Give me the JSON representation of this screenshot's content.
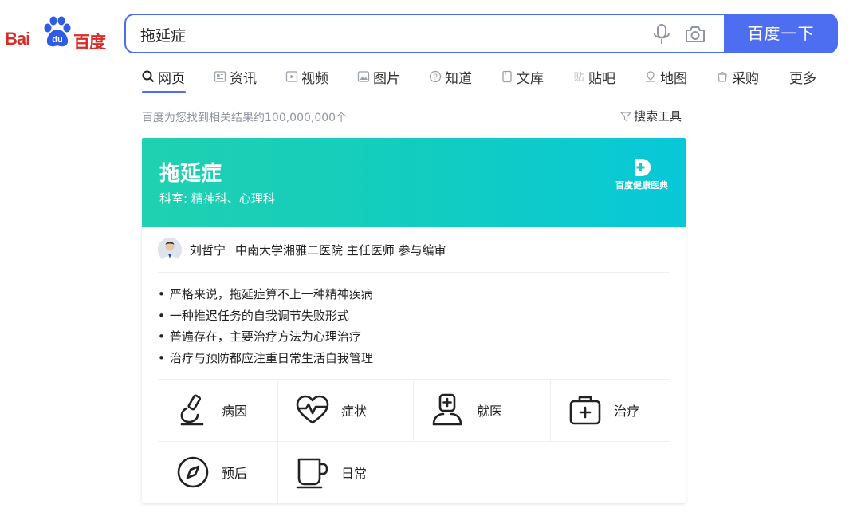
{
  "logo": {
    "part1": "Bai",
    "part2": "百度",
    "paw_text": "du"
  },
  "search": {
    "query": "拖延症",
    "button_label": "百度一下"
  },
  "tabs": [
    {
      "label": "网页",
      "icon": "search-icon"
    },
    {
      "label": "资讯",
      "icon": "news-icon"
    },
    {
      "label": "视频",
      "icon": "video-icon"
    },
    {
      "label": "图片",
      "icon": "image-icon"
    },
    {
      "label": "知道",
      "icon": "question-icon"
    },
    {
      "label": "文库",
      "icon": "document-icon"
    },
    {
      "label": "贴吧",
      "icon": "tieba-icon"
    },
    {
      "label": "地图",
      "icon": "map-icon"
    },
    {
      "label": "采购",
      "icon": "shopping-icon"
    },
    {
      "label": "更多",
      "icon": ""
    }
  ],
  "results": {
    "count_text": "百度为您找到相关结果约100,000,000个",
    "tools_label": "搜索工具"
  },
  "card": {
    "title": "拖延症",
    "subtitle": "科室: 精神科、心理科",
    "brand": "百度健康医典",
    "author": {
      "name": "刘哲宁",
      "affiliation": "中南大学湘雅二医院 主任医师 参与编审"
    },
    "bullets": [
      "严格来说，拖延症算不上一种精神疾病",
      "一种推迟任务的自我调节失败形式",
      "普遍存在，主要治疗方法为心理治疗",
      "治疗与预防都应注重日常生活自我管理"
    ],
    "sections": [
      {
        "label": "病因",
        "icon": "microscope-icon"
      },
      {
        "label": "症状",
        "icon": "heartbeat-icon"
      },
      {
        "label": "就医",
        "icon": "doctor-icon"
      },
      {
        "label": "治疗",
        "icon": "medical-kit-icon"
      },
      {
        "label": "预后",
        "icon": "compass-icon"
      },
      {
        "label": "日常",
        "icon": "cup-icon"
      }
    ]
  },
  "colors": {
    "accent": "#4e6ef2",
    "brand_red": "#d92c26",
    "header_teal": "#12cdbf"
  }
}
